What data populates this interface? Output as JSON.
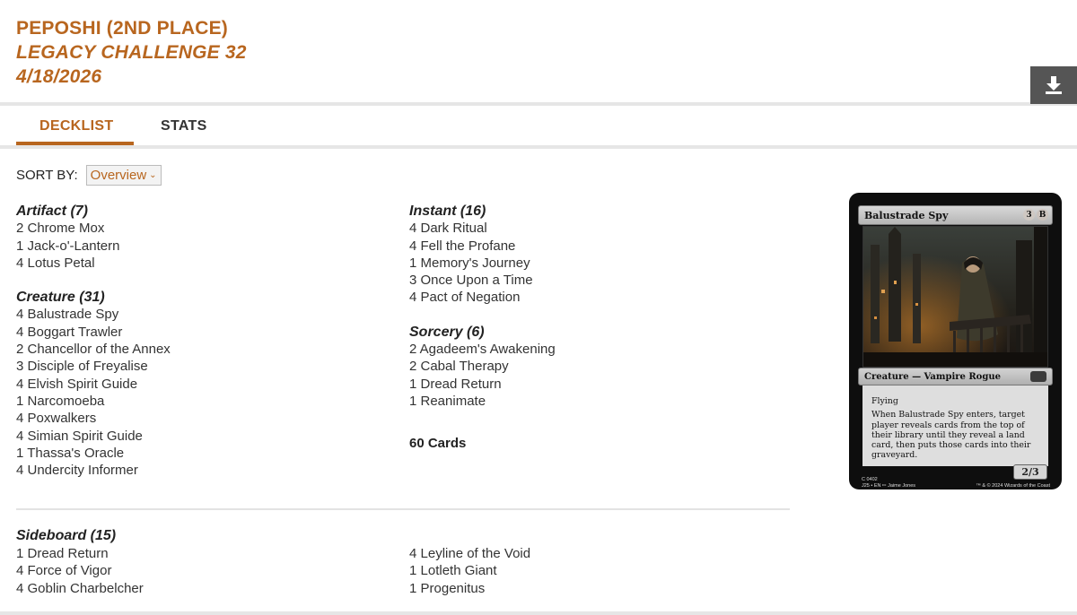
{
  "header": {
    "player": "PEPOSHI (2ND PLACE)",
    "event": "LEGACY CHALLENGE 32",
    "date": "4/18/2026"
  },
  "tabs": [
    {
      "label": "DECKLIST",
      "active": true
    },
    {
      "label": "STATS",
      "active": false
    }
  ],
  "sort": {
    "label": "SORT BY:",
    "selected": "Overview"
  },
  "left_groups": [
    {
      "title": "Artifact (7)",
      "cards": [
        "2 Chrome Mox",
        "1 Jack-o'-Lantern",
        "4 Lotus Petal"
      ]
    },
    {
      "title": "Creature (31)",
      "cards": [
        "4 Balustrade Spy",
        "4 Boggart Trawler",
        "2 Chancellor of the Annex",
        "3 Disciple of Freyalise",
        "4 Elvish Spirit Guide",
        "1 Narcomoeba",
        "4 Poxwalkers",
        "4 Simian Spirit Guide",
        "1 Thassa's Oracle",
        "4 Undercity Informer"
      ]
    }
  ],
  "right_groups": [
    {
      "title": "Instant (16)",
      "cards": [
        "4 Dark Ritual",
        "4 Fell the Profane",
        "1 Memory's Journey",
        "3 Once Upon a Time",
        "4 Pact of Negation"
      ]
    },
    {
      "title": "Sorcery (6)",
      "cards": [
        "2 Agadeem's Awakening",
        "2 Cabal Therapy",
        "1 Dread Return",
        "1 Reanimate"
      ]
    }
  ],
  "total": "60 Cards",
  "sideboard": {
    "title": "Sideboard (15)",
    "left": [
      "1 Dread Return",
      "4 Force of Vigor",
      "4 Goblin Charbelcher"
    ],
    "right": [
      "4 Leyline of the Void",
      "1 Lotleth Giant",
      "1 Progenitus"
    ]
  },
  "card_preview": {
    "name": "Balustrade Spy",
    "mana_generic": "3",
    "mana_black": "B",
    "type_line": "Creature — Vampire Rogue",
    "keyword": "Flying",
    "rules_text": "When Balustrade Spy enters, target player reveals cards from the top of their library until they reveal a land card, then puts those cards into their graveyard.",
    "pt": "2/3",
    "collector_line1": "C 0402",
    "collector_line2": "J25 • EN ✏ Jaime Jones",
    "copyright": "™ & © 2024 Wizards of the Coast"
  },
  "colors": {
    "accent": "#b8661f",
    "download_bg": "#555555"
  },
  "icons": {
    "download": "download-icon"
  }
}
